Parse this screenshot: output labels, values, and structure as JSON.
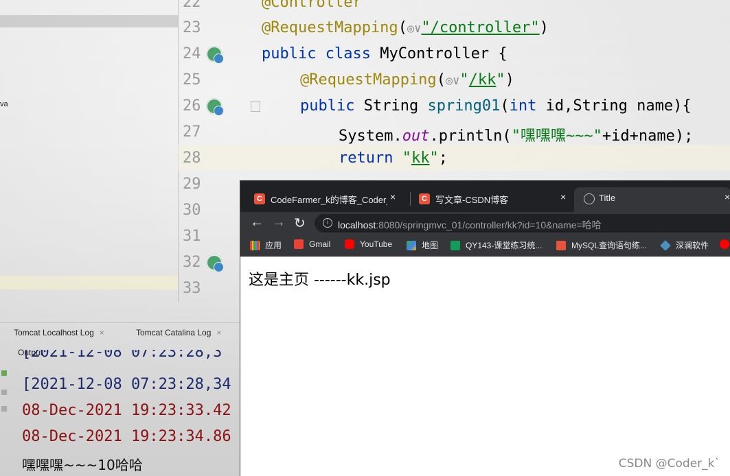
{
  "project": {
    "java_label": "va"
  },
  "editor": {
    "line_numbers": [
      "22",
      "23",
      "24",
      "25",
      "26",
      "27",
      "28",
      "29",
      "30",
      "31",
      "32",
      "33"
    ],
    "code": {
      "l22": "@Controller",
      "l23_ann": "@RequestMapping",
      "l23_open": "(",
      "l23_icons": "◎∨",
      "l23_str": "\"/controller\"",
      "l23_close": ")",
      "l24_kw": "public class",
      "l24_rest": " MyController {",
      "l25_ann": "@RequestMapping",
      "l25_open": "(",
      "l25_icons": "◎∨",
      "l25_q1": "\"",
      "l25_path": "/kk",
      "l25_q2": "\"",
      "l25_close": ")",
      "l26_kw": "public",
      "l26_type": " String ",
      "l26_method": "spring01",
      "l26_p1": "(",
      "l26_int": "int",
      "l26_rest": " id,String name){",
      "l27_a": "System.",
      "l27_out": "out",
      "l27_b": ".println(",
      "l27_str": "\"嘿嘿嘿~~~\"",
      "l27_c": "+id+name);",
      "l28_kw": "return",
      "l28_sp": " ",
      "l28_q1": "\"",
      "l28_val": "kk",
      "l28_q2": "\"",
      "l28_semi": ";"
    }
  },
  "run_panel": {
    "tabs": [
      {
        "label": "Tomcat Localhost Log",
        "close": "×"
      },
      {
        "label": "Tomcat Catalina Log",
        "close": "×"
      }
    ],
    "output_label": "Output",
    "log_lines": [
      "[2021-12-08 07:23:28,3",
      "[2021-12-08 07:23:28,34",
      "08-Dec-2021 19:23:33.42",
      "08-Dec-2021 19:23:34.86",
      "嘿嘿嘿~~~10哈哈"
    ]
  },
  "browser": {
    "tabs": [
      {
        "icon": "C",
        "title": "CodeFarmer_k的博客_Coder_k",
        "close": "×"
      },
      {
        "icon": "C",
        "title": "写文章-CSDN博客",
        "close": "×"
      },
      {
        "icon": "globe",
        "title": "Title",
        "close": "×"
      }
    ],
    "url_host": "localhost",
    "url_rest": ":8080/springmvc_01/controller/kk?id=10&name=哈哈",
    "nav": {
      "back": "←",
      "forward": "→",
      "reload": "↻",
      "info": "i"
    },
    "bookmarks": [
      {
        "label": "应用",
        "color": "#e8eaed"
      },
      {
        "label": "Gmail",
        "color": "#ea4335"
      },
      {
        "label": "YouTube",
        "color": "#ff0000"
      },
      {
        "label": "地图",
        "color": "#34a853"
      },
      {
        "label": "QY143-课堂练习统...",
        "color": "#0f9d58"
      },
      {
        "label": "MySQL查询语句练...",
        "color": "#e8543b"
      },
      {
        "label": "深澜软件",
        "color": "#4a90c2"
      }
    ],
    "page_text": "这是主页 ------kk.jsp"
  },
  "watermark": "CSDN @Coder_k`"
}
